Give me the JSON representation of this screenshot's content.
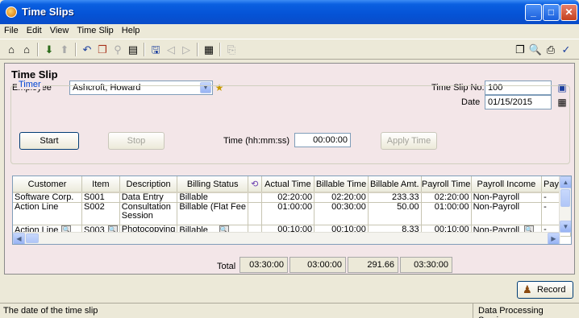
{
  "window": {
    "title": "Time Slips"
  },
  "menu": [
    "File",
    "Edit",
    "View",
    "Time Slip",
    "Help"
  ],
  "toolbar": {
    "left_icons": [
      "home-icon",
      "home-alt-icon",
      "import-icon",
      "export-icon",
      "undo-icon",
      "copy-icon",
      "filter-icon",
      "note-icon",
      "save-icon",
      "prev-icon",
      "next-icon",
      "calculator-icon",
      "report-icon"
    ],
    "right_icons": [
      "window-icon",
      "preview-icon",
      "print-icon",
      "check-icon"
    ]
  },
  "form": {
    "section_title": "Time Slip",
    "employee_label": "Employee",
    "employee_value": "Ashcroft, Howard",
    "slip_no_label": "Time Slip No.",
    "slip_no_value": "100",
    "date_label": "Date",
    "date_value": "01/15/2015"
  },
  "timer": {
    "label": "Timer",
    "start": "Start",
    "stop": "Stop",
    "time_label": "Time (hh:mm:ss)",
    "time_value": "00:00:00",
    "apply": "Apply Time"
  },
  "table": {
    "columns": [
      "Customer",
      "Item",
      "Description",
      "Billing Status",
      "",
      "Actual Time",
      "Billable Time",
      "Billable Amt.",
      "Payroll Time",
      "Payroll Income",
      "Payrol"
    ],
    "rows": [
      {
        "customer": "Software Corp.",
        "item": "S001",
        "description": "Data Entry",
        "billing_status": "Billable",
        "actual_time": "02:20:00",
        "billable_time": "02:20:00",
        "billable_amt": "233.33",
        "payroll_time": "02:20:00",
        "payroll_income": "Non-Payroll",
        "payroll_extra": "-"
      },
      {
        "customer": "Action Line",
        "item": "S002",
        "description": "Consultation Session",
        "billing_status": "Billable (Flat Fee",
        "actual_time": "01:00:00",
        "billable_time": "00:30:00",
        "billable_amt": "50.00",
        "payroll_time": "01:00:00",
        "payroll_income": "Non-Payroll",
        "payroll_extra": "-"
      },
      {
        "customer": "Action Line",
        "item": "S003",
        "description": "Photocopying",
        "billing_status": "Billable",
        "actual_time": "00:10:00",
        "billable_time": "00:10:00",
        "billable_amt": "8.33",
        "payroll_time": "00:10:00",
        "payroll_income": "Non-Payroll",
        "payroll_extra": "-"
      }
    ]
  },
  "totals": {
    "label": "Total",
    "actual_time": "03:30:00",
    "billable_time": "03:00:00",
    "billable_amt": "291.66",
    "payroll_time": "03:30:00"
  },
  "record_button": "Record",
  "status": {
    "message": "The date of the time slip",
    "company": "Data Processing Services"
  },
  "colors": {
    "title_bar": "#0553d6",
    "panel_bg": "#f3e6e8",
    "chrome_bg": "#ece9d8",
    "group_label": "#0046d5"
  }
}
